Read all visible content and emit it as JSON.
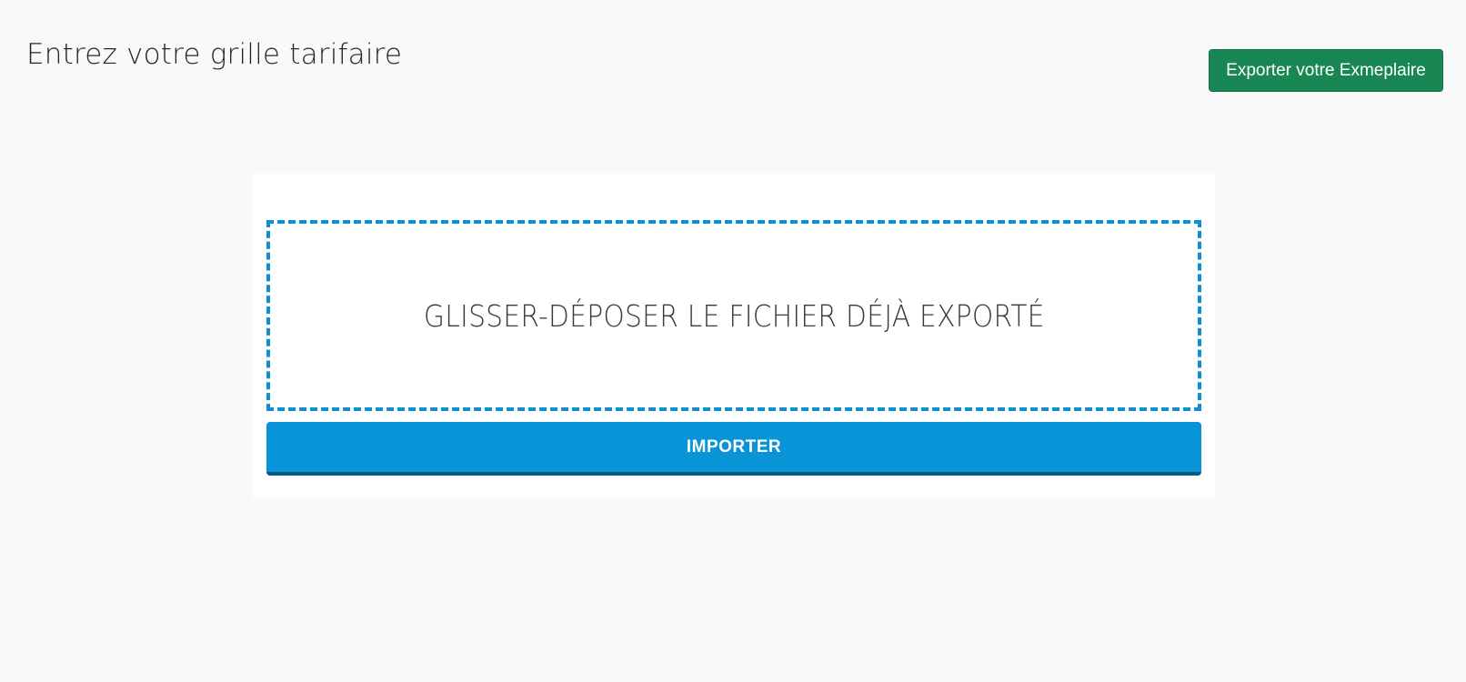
{
  "header": {
    "title": "Entrez votre grille tarifaire",
    "export_label": "Exporter votre Exmeplaire"
  },
  "upload": {
    "dropzone_label": "GLISSER-DÉPOSER LE FICHIER DÉJÀ EXPORTÉ",
    "import_label": "IMPORTER"
  },
  "colors": {
    "background": "#f8f9fa",
    "export_button": "#198754",
    "dropzone_border": "#0c8fd3",
    "import_button": "#0a94d8",
    "import_button_shadow": "#06587f"
  }
}
